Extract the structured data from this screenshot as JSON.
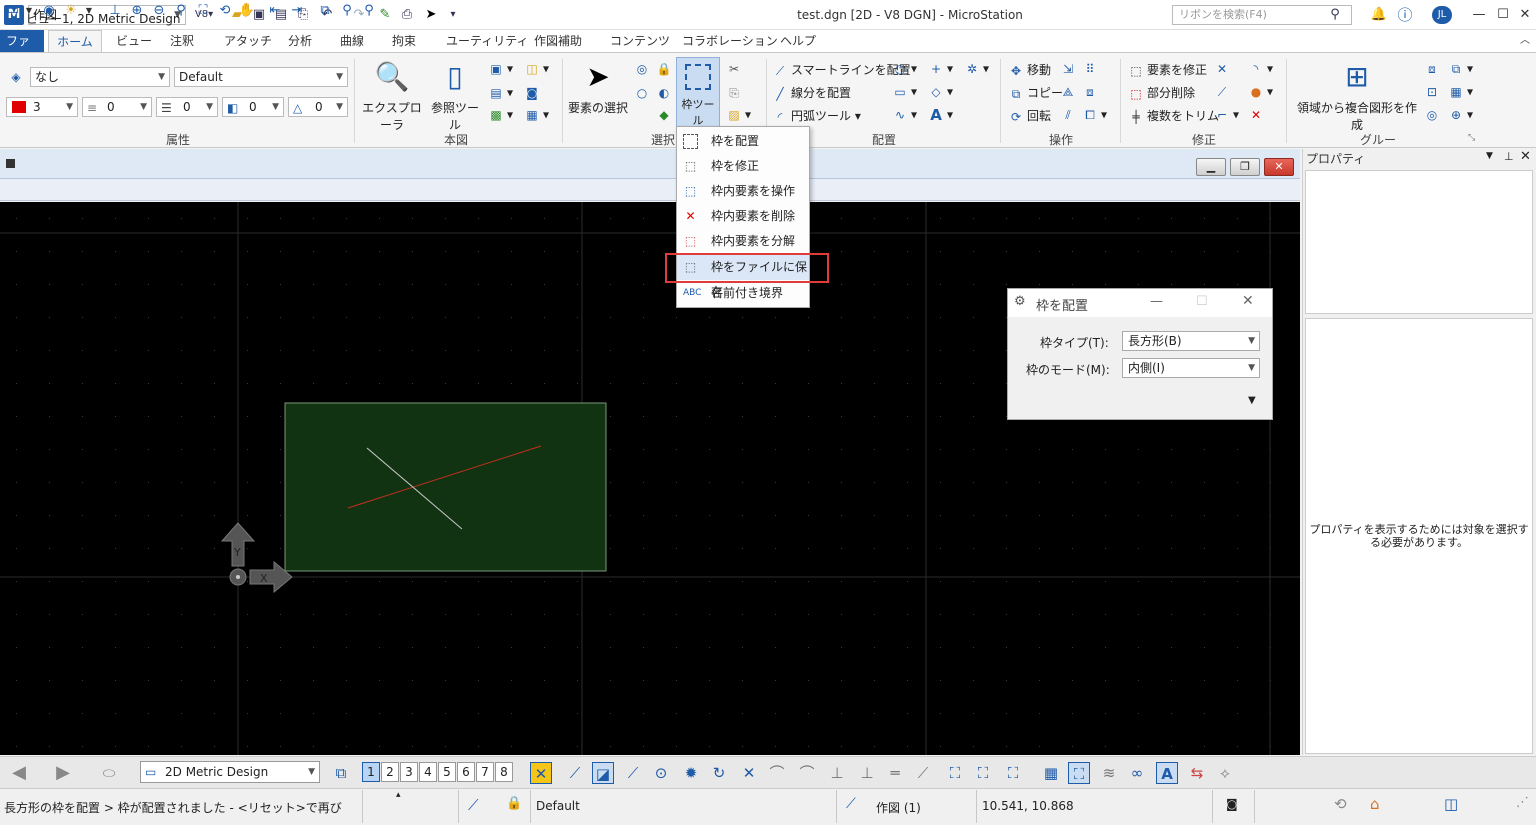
{
  "titlebar": {
    "workflow": "作図",
    "version_badge": "V8",
    "window_title": "test.dgn [2D - V8 DGN] - MicroStation",
    "search_placeholder": "リボンを検索(F4)",
    "user_initials": "JL"
  },
  "tabs": [
    "ファイル",
    "ホーム",
    "ビュー",
    "注釈",
    "アタッチ",
    "分析",
    "曲線",
    "拘束",
    "ユーティリティ",
    "作図補助",
    "コンテンツ",
    "コラボレーション",
    "ヘルプ"
  ],
  "ribbon": {
    "attributes": {
      "label": "属性",
      "level": "なし",
      "style": "Default",
      "color": "3",
      "weight": "0",
      "linestyle": "0",
      "transparency": "0",
      "priority": "0"
    },
    "primary": {
      "label": "本図",
      "explorer": "エクスプローラ",
      "reference_tools": "参照ツール"
    },
    "selection": {
      "label": "選択",
      "select_element": "要素の選択",
      "fence_tools": "枠ツール"
    },
    "placement": {
      "label": "配置",
      "smartline": "スマートラインを配置",
      "place_line": "線分を配置",
      "arc_tools": "円弧ツール"
    },
    "manipulate": {
      "label": "操作",
      "move": "移動",
      "copy": "コピー",
      "rotate": "回転"
    },
    "modify": {
      "label": "修正",
      "modify_element": "要素を修正",
      "partial_delete": "部分削除",
      "trim_multiple": "複数をトリム"
    },
    "groups": {
      "label": "グループ",
      "create_region": "領域から複合図形を作成"
    }
  },
  "fence_menu": {
    "items": [
      "枠を配置",
      "枠を修正",
      "枠内要素を操作",
      "枠内要素を削除",
      "枠内要素を分解",
      "枠をファイルに保存",
      "名前付き境界"
    ],
    "highlighted_index": 5
  },
  "view": {
    "title": "ビュー1, 2D Metric Design"
  },
  "fence_dialog": {
    "title": "枠を配置",
    "type_label": "枠タイプ(T):",
    "type_value": "長方形(B)",
    "mode_label": "枠のモード(M):",
    "mode_value": "内側(I)"
  },
  "properties": {
    "title": "プロパティ",
    "message": "プロパティを表示するためには対象を選択する必要があります。"
  },
  "bottom_toolbar": {
    "model": "2D Metric Design",
    "view_numbers": [
      "1",
      "2",
      "3",
      "4",
      "5",
      "6",
      "7",
      "8"
    ],
    "active_view": 0
  },
  "status": {
    "prompt": "長方形の枠を配置 > 枠が配置されました - <リセット>で再び",
    "level": "Default",
    "model": "作図 (1)",
    "coordinates": "10.541, 10.868"
  }
}
